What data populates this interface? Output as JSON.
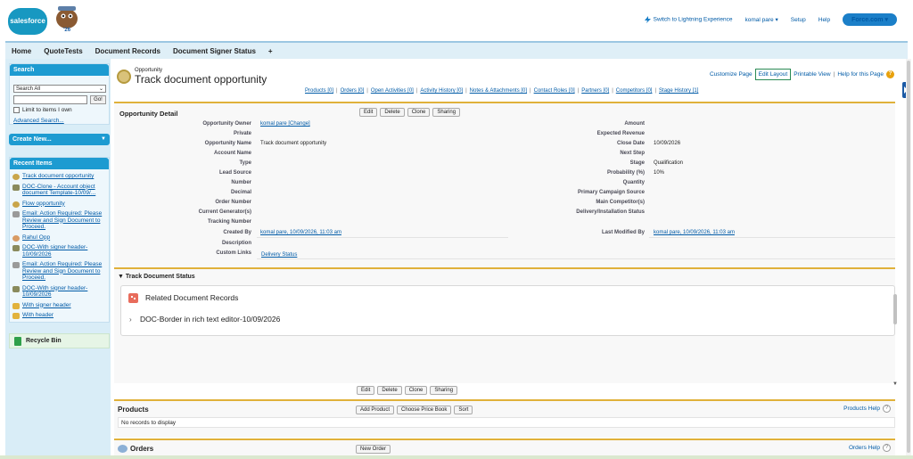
{
  "header": {
    "logo_text": "salesforce",
    "mascot_year": "'26",
    "switch_lightning": "Switch to Lightning Experience",
    "user_menu": "komal pare",
    "setup": "Setup",
    "help": "Help",
    "app_switcher": "Force.com"
  },
  "tabs": [
    "Home",
    "QuoteTests",
    "Document Records",
    "Document Signer Status",
    "+"
  ],
  "sidebar": {
    "search": {
      "title": "Search",
      "scope": "Search All",
      "go": "Go!",
      "limit_label": "Limit to items I own",
      "advanced": "Advanced Search..."
    },
    "create_new": "Create New...",
    "recent": {
      "title": "Recent Items",
      "items": [
        {
          "label": "Track document opportunity",
          "icon": "opportunity-icon"
        },
        {
          "label": "DOC-Clone - Account object document Template-10/09/...",
          "icon": "document-record-icon"
        },
        {
          "label": "Flow opportunity",
          "icon": "opportunity-icon"
        },
        {
          "label": "Email: Action Required: Please Review and Sign Document to Proceed.",
          "icon": "email-icon"
        },
        {
          "label": "Rahul Opp",
          "icon": "opportunity-icon"
        },
        {
          "label": "DOC-With signer header-10/09/2026",
          "icon": "document-record-icon"
        },
        {
          "label": "Email: Action Required: Please Review and Sign Document to Proceed.",
          "icon": "email-icon"
        },
        {
          "label": "DOC-With signer header-10/09/2026",
          "icon": "document-record-icon"
        },
        {
          "label": "With signer header",
          "icon": "template-icon"
        },
        {
          "label": "With header",
          "icon": "template-icon"
        }
      ]
    },
    "recycle_bin": "Recycle Bin"
  },
  "record": {
    "object_type": "Opportunity",
    "title": "Track document opportunity",
    "top_links": {
      "customize": "Customize Page",
      "edit_layout": "Edit Layout",
      "printable": "Printable View",
      "help": "Help for this Page"
    },
    "related_links": [
      "Products [0]",
      "Orders [0]",
      "Open Activities [0]",
      "Activity History [0]",
      "Notes & Attachments [0]",
      "Contact Roles [0]",
      "Partners [0]",
      "Competitors [0]",
      "Stage History [1]"
    ],
    "detail_title": "Opportunity Detail",
    "buttons": [
      "Edit",
      "Delete",
      "Clone",
      "Sharing"
    ],
    "left_fields": [
      {
        "label": "Opportunity Owner",
        "value": "komal pare [Change]",
        "link": true
      },
      {
        "label": "Private",
        "value": ""
      },
      {
        "label": "Opportunity Name",
        "value": "Track document opportunity"
      },
      {
        "label": "Account Name",
        "value": ""
      },
      {
        "label": "Type",
        "value": ""
      },
      {
        "label": "Lead Source",
        "value": ""
      },
      {
        "label": "Number",
        "value": ""
      },
      {
        "label": "Decimal",
        "value": ""
      },
      {
        "label": "Order Number",
        "value": ""
      },
      {
        "label": "Current Generator(s)",
        "value": ""
      },
      {
        "label": "Tracking Number",
        "value": ""
      },
      {
        "label": "Created By",
        "value": "komal pare, 10/09/2026, 11:03 am",
        "link": true
      },
      {
        "label": "Description",
        "value": ""
      },
      {
        "label": "Custom Links",
        "value": "Delivery Status",
        "link": true
      }
    ],
    "right_fields": [
      {
        "label": "Amount",
        "value": ""
      },
      {
        "label": "Expected Revenue",
        "value": ""
      },
      {
        "label": "Close Date",
        "value": "10/09/2026"
      },
      {
        "label": "Next Step",
        "value": ""
      },
      {
        "label": "Stage",
        "value": "Qualification"
      },
      {
        "label": "Probability (%)",
        "value": "10%"
      },
      {
        "label": "Quantity",
        "value": ""
      },
      {
        "label": "Primary Campaign Source",
        "value": ""
      },
      {
        "label": "Main Competitor(s)",
        "value": ""
      },
      {
        "label": "Delivery/Installation Status",
        "value": ""
      }
    ],
    "last_modified": {
      "label": "Last Modified By",
      "value": "komal pare, 10/09/2026, 11:03 am"
    }
  },
  "track_doc": {
    "title": "Track Document Status",
    "card_title": "Related Document Records",
    "item": "DOC-Border in rich text editor-10/09/2026"
  },
  "products": {
    "title": "Products",
    "buttons": [
      "Add Product",
      "Choose Price Book",
      "Sort"
    ],
    "help": "Products Help",
    "empty": "No records to display"
  },
  "orders": {
    "title": "Orders",
    "buttons": [
      "New Order"
    ],
    "help": "Orders Help"
  }
}
